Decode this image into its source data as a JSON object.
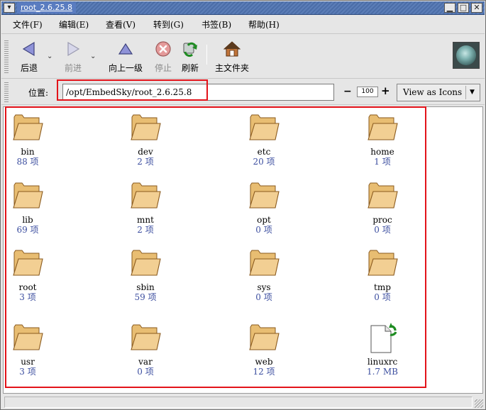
{
  "window": {
    "title": "root_2.6.25.8",
    "menu_glyph": "▾",
    "minimize": "▁",
    "maximize": "□",
    "close": "✕"
  },
  "menubar": {
    "items": [
      "文件(F)",
      "编辑(E)",
      "查看(V)",
      "转到(G)",
      "书签(B)",
      "帮助(H)"
    ]
  },
  "toolbar": {
    "back": "后退",
    "forward": "前进",
    "up": "向上一级",
    "stop": "停止",
    "reload": "刷新",
    "home": "主文件夹",
    "dropdown_glyph": "⌄"
  },
  "location": {
    "label": "位置:",
    "path": "/opt/EmbedSky/root_2.6.25.8",
    "zoom_minus": "−",
    "zoom_value": "100",
    "zoom_plus": "+",
    "view_mode": "View as Icons",
    "view_arrow": "▼"
  },
  "files": [
    {
      "name": "bin",
      "count": "88 项",
      "icon": "folder-icon"
    },
    {
      "name": "dev",
      "count": "2 项",
      "icon": "folder-icon"
    },
    {
      "name": "etc",
      "count": "20 项",
      "icon": "folder-icon"
    },
    {
      "name": "home",
      "count": "1 项",
      "icon": "folder-icon"
    },
    {
      "name": "lib",
      "count": "69 项",
      "icon": "folder-icon"
    },
    {
      "name": "mnt",
      "count": "2 项",
      "icon": "folder-icon"
    },
    {
      "name": "opt",
      "count": "0 项",
      "icon": "folder-icon"
    },
    {
      "name": "proc",
      "count": "0 项",
      "icon": "folder-icon"
    },
    {
      "name": "root",
      "count": "3 项",
      "icon": "folder-icon"
    },
    {
      "name": "sbin",
      "count": "59 项",
      "icon": "folder-icon"
    },
    {
      "name": "sys",
      "count": "0 项",
      "icon": "folder-icon"
    },
    {
      "name": "tmp",
      "count": "0 项",
      "icon": "folder-icon"
    },
    {
      "name": "usr",
      "count": "3 项",
      "icon": "folder-icon"
    },
    {
      "name": "var",
      "count": "0 项",
      "icon": "folder-icon"
    },
    {
      "name": "web",
      "count": "12 项",
      "icon": "folder-icon"
    },
    {
      "name": "linuxrc",
      "count": "1.7 MB",
      "icon": "symlink-file-icon"
    }
  ],
  "colors": {
    "highlight": "#e3131a",
    "folder_fill": "#f2cf93",
    "folder_stroke": "#8a5a1e",
    "count_text": "#3d4fa0",
    "titlebar": "#4c6ea8"
  }
}
